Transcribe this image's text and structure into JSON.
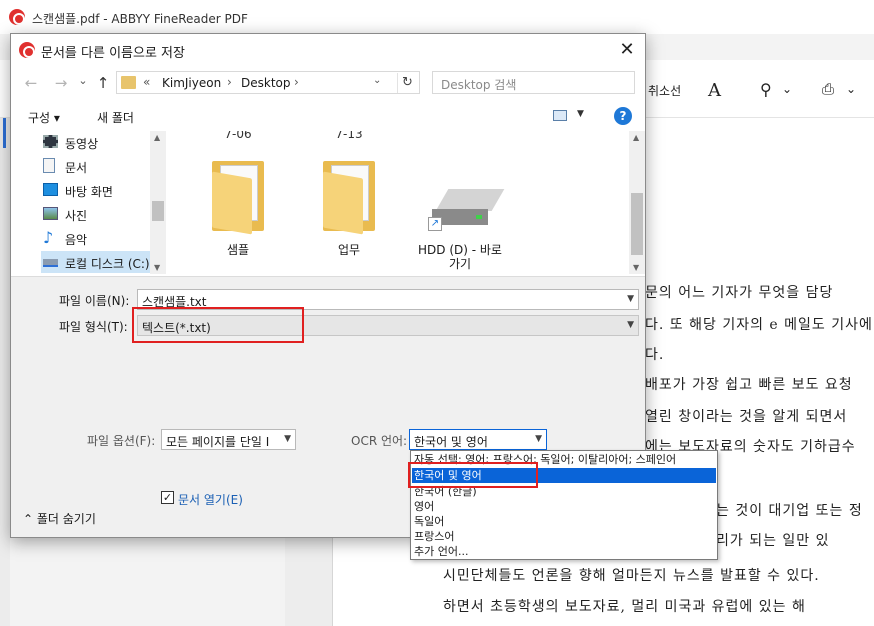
{
  "app": {
    "title": "스캔샘플.pdf - ABBYY FineReader PDF",
    "toolbar": {
      "cancel_label": "취소선",
      "text_tool": "A",
      "stamp_arrow": "⌄",
      "sign_arrow": "⌄"
    }
  },
  "document": {
    "lines": [
      "문의 어느 기자가 무엇을 담당",
      "다. 또 해당 기자의 e 메일도 기사에",
      "다.",
      "배포가 가장 쉽고 빠른 보도 요청",
      "열린 창이라는 것을 알게 되면서",
      "에는 보도자료의 숫자도 기하급수",
      "는 것이 대기업 또는 정",
      "리가 되는 일만 있",
      "시민단체들도 언론을 향해 얼마든지 뉴스를 발표할 수 있다.",
      "하면서 초등학생의 보도자료, 멀리 미국과 유럽에 있는 해"
    ]
  },
  "dialog": {
    "title": "문서를 다른 이름으로 저장",
    "close_glyph": "✕",
    "nav": {
      "back": "←",
      "forward": "→",
      "recent": "⌄",
      "up": "↑"
    },
    "address": {
      "chevron": "«",
      "segments": [
        "KimJiyeon",
        "Desktop"
      ],
      "separator": "›",
      "dropdown": "⌄",
      "refresh": "↻"
    },
    "search_placeholder": "Desktop 검색",
    "commands": {
      "organize": "구성 ▾",
      "new_folder": "새 폴더",
      "view_arrow": "▼",
      "help": "?"
    },
    "tree": [
      {
        "label": "동영상",
        "icon": "video-icon"
      },
      {
        "label": "문서",
        "icon": "document-icon"
      },
      {
        "label": "바탕 화면",
        "icon": "desktop-icon"
      },
      {
        "label": "사진",
        "icon": "pictures-icon"
      },
      {
        "label": "음악",
        "icon": "music-icon"
      },
      {
        "label": "로컬 디스크 (C:)",
        "icon": "local-disk-icon"
      }
    ],
    "files": [
      {
        "cut_label": "7-06",
        "label": "샘플",
        "type": "folder"
      },
      {
        "cut_label": "7-13",
        "label": "업무",
        "type": "folder"
      },
      {
        "cut_label": "",
        "label": "HDD (D) - 바로 가기",
        "type": "drive"
      }
    ],
    "form": {
      "filename_label": "파일 이름(N):",
      "filename_value": "스캔샘플.txt",
      "filetype_label": "파일 형식(T):",
      "filetype_value": "텍스트(*.txt)",
      "file_options_label": "파일 옵션(F):",
      "file_options_value": "모든 페이지를 단일 I",
      "ocr_label": "OCR 언어:",
      "ocr_value": "한국어 및 영어",
      "open_doc_label": "문서 열기(E)",
      "open_doc_checked": "✓",
      "hide_folders": "⌃  폴더 숨기기"
    },
    "ocr_options": [
      "자동 선택: 영어; 프랑스어; 독일어; 이탈리아어; 스페인어",
      "한국어 및 영어",
      "한국어 (한글)",
      "영어",
      "독일어",
      "프랑스어",
      "추가 언어..."
    ],
    "ocr_selected_index": 1
  },
  "colors": {
    "accent": "#0a64d8",
    "highlight_box": "#e02020",
    "brand": "#e0312f"
  }
}
